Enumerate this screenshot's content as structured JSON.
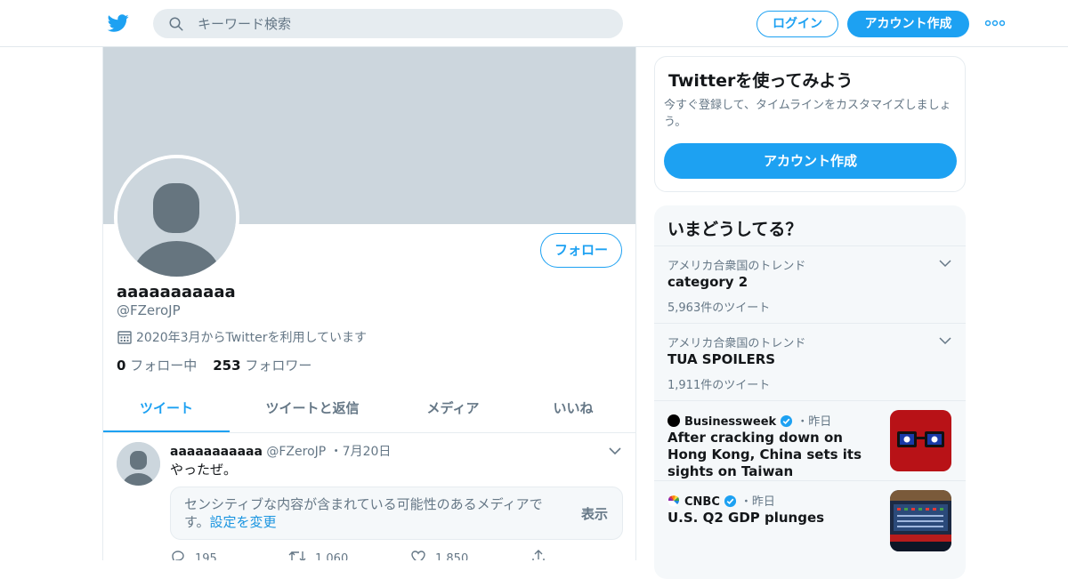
{
  "header": {
    "search_placeholder": "キーワード検索",
    "login_label": "ログイン",
    "signup_label": "アカウント作成",
    "brand_color": "#1da1f2"
  },
  "profile": {
    "display_name": "aaaaaaaaaaa",
    "handle": "@FZeroJP",
    "joined": "2020年3月からTwitterを利用しています",
    "following_count": "0",
    "following_label": "フォロー中",
    "followers_count": "253",
    "followers_label": "フォロワー",
    "follow_button": "フォロー"
  },
  "tabs": [
    {
      "label": "ツイート",
      "active": true
    },
    {
      "label": "ツイートと返信",
      "active": false
    },
    {
      "label": "メディア",
      "active": false
    },
    {
      "label": "いいね",
      "active": false
    }
  ],
  "tweet": {
    "name": "aaaaaaaaaaa",
    "handle": "@FZeroJP",
    "date": "7月20日",
    "text": "やったぜ。",
    "sensitive_msg": "センシティブな内容が含まれている可能性のあるメディアです。",
    "sensitive_link": "設定を変更",
    "show_label": "表示",
    "replies": "195",
    "retweets": "1,060",
    "likes": "1,850"
  },
  "sidebar": {
    "signup_card": {
      "title": "Twitterを使ってみよう",
      "description": "今すぐ登録して、タイムラインをカスタマイズしましょう。",
      "button": "アカウント作成"
    },
    "trends": {
      "title": "いまどうしてる？",
      "items": [
        {
          "context": "アメリカ合衆国のトレンド",
          "name": "category 2",
          "count": "5,963件のツイート"
        },
        {
          "context": "アメリカ合衆国のトレンド",
          "name": "TUA SPOILERS",
          "count": "1,911件のツイート"
        }
      ],
      "news": [
        {
          "source": "Businessweek",
          "time": "昨日",
          "headline": "After cracking down on Hong Kong, China sets its sights on Taiwan"
        },
        {
          "source": "CNBC",
          "time": "昨日",
          "headline": "U.S. Q2 GDP plunges"
        }
      ]
    }
  }
}
